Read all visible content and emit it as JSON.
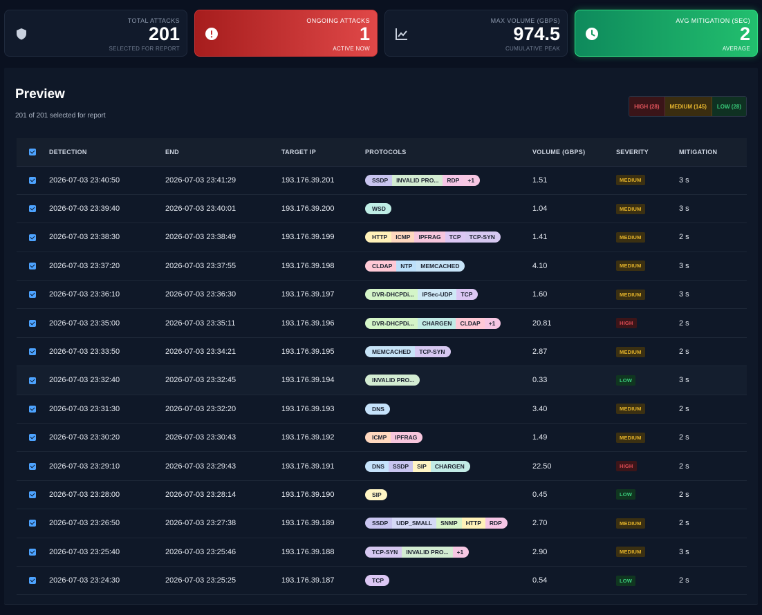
{
  "stats": {
    "total": {
      "label": "TOTAL ATTACKS",
      "value": "201",
      "sub": "SELECTED FOR REPORT",
      "icon": "shield-icon"
    },
    "ongoing": {
      "label": "ONGOING ATTACKS",
      "value": "1",
      "sub": "ACTIVE NOW",
      "icon": "alert-icon"
    },
    "volume": {
      "label": "MAX VOLUME (GBPS)",
      "value": "974.5",
      "sub": "CUMULATIVE PEAK",
      "icon": "chart-line-icon"
    },
    "mitigation": {
      "label": "AVG MITIGATION (SEC)",
      "value": "2",
      "sub": "AVERAGE",
      "icon": "clock-icon"
    }
  },
  "preview": {
    "title": "Preview",
    "subtitle": "201 of 201 selected for report",
    "legend": {
      "high": "HIGH (28)",
      "medium": "MEDIUM (145)",
      "low": "LOW (28)"
    }
  },
  "colors": {
    "SSDP": "#c9c5f0",
    "INVALID PRO...": "#d3ecd2",
    "RDP": "#f6c6e6",
    "+1": "#f7c7e3",
    "WSD": "#bfeee6",
    "HTTP": "#fff1b8",
    "ICMP": "#ffd8bf",
    "IPFRAG": "#f7c6dd",
    "TCP": "#dcc7f4",
    "TCP-SYN": "#d6c8f1",
    "CLDAP": "#ffc9d6",
    "NTP": "#bde0fb",
    "MEMCACHED": "#c6e3f7",
    "DVR-DHCPDi...": "#d4f5c8",
    "IPSec-UDP": "#cfe9f6",
    "CHARGEN": "#c2ebe6",
    "DNS": "#c5e2fb",
    "SIP": "#fff5c4",
    "UDP_SMALL": "#d5d9f6",
    "SNMP": "#d8f3c9"
  },
  "table": {
    "headers": [
      "DETECTION",
      "END",
      "TARGET IP",
      "PROTOCOLS",
      "VOLUME (GBPS)",
      "SEVERITY",
      "MITIGATION"
    ],
    "rows": [
      {
        "detection": "2026-07-03 23:40:50",
        "end": "2026-07-03 23:41:29",
        "ip": "193.176.39.201",
        "protocols": [
          "SSDP",
          "INVALID PRO...",
          "RDP",
          "+1"
        ],
        "volume": "1.51",
        "severity": "MEDIUM",
        "mitigation": "3 s"
      },
      {
        "detection": "2026-07-03 23:39:40",
        "end": "2026-07-03 23:40:01",
        "ip": "193.176.39.200",
        "protocols": [
          "WSD"
        ],
        "volume": "1.04",
        "severity": "MEDIUM",
        "mitigation": "3 s"
      },
      {
        "detection": "2026-07-03 23:38:30",
        "end": "2026-07-03 23:38:49",
        "ip": "193.176.39.199",
        "protocols": [
          "HTTP",
          "ICMP",
          "IPFRAG",
          "TCP",
          "TCP-SYN"
        ],
        "volume": "1.41",
        "severity": "MEDIUM",
        "mitigation": "2 s"
      },
      {
        "detection": "2026-07-03 23:37:20",
        "end": "2026-07-03 23:37:55",
        "ip": "193.176.39.198",
        "protocols": [
          "CLDAP",
          "NTP",
          "MEMCACHED"
        ],
        "volume": "4.10",
        "severity": "MEDIUM",
        "mitigation": "3 s"
      },
      {
        "detection": "2026-07-03 23:36:10",
        "end": "2026-07-03 23:36:30",
        "ip": "193.176.39.197",
        "protocols": [
          "DVR-DHCPDi...",
          "IPSec-UDP",
          "TCP"
        ],
        "volume": "1.60",
        "severity": "MEDIUM",
        "mitigation": "3 s"
      },
      {
        "detection": "2026-07-03 23:35:00",
        "end": "2026-07-03 23:35:11",
        "ip": "193.176.39.196",
        "protocols": [
          "DVR-DHCPDi...",
          "CHARGEN",
          "CLDAP",
          "+1"
        ],
        "volume": "20.81",
        "severity": "HIGH",
        "mitigation": "2 s"
      },
      {
        "detection": "2026-07-03 23:33:50",
        "end": "2026-07-03 23:34:21",
        "ip": "193.176.39.195",
        "protocols": [
          "MEMCACHED",
          "TCP-SYN"
        ],
        "volume": "2.87",
        "severity": "MEDIUM",
        "mitigation": "2 s"
      },
      {
        "detection": "2026-07-03 23:32:40",
        "end": "2026-07-03 23:32:45",
        "ip": "193.176.39.194",
        "protocols": [
          "INVALID PRO..."
        ],
        "volume": "0.33",
        "severity": "LOW",
        "mitigation": "3 s",
        "highlight": true
      },
      {
        "detection": "2026-07-03 23:31:30",
        "end": "2026-07-03 23:32:20",
        "ip": "193.176.39.193",
        "protocols": [
          "DNS"
        ],
        "volume": "3.40",
        "severity": "MEDIUM",
        "mitigation": "2 s"
      },
      {
        "detection": "2026-07-03 23:30:20",
        "end": "2026-07-03 23:30:43",
        "ip": "193.176.39.192",
        "protocols": [
          "ICMP",
          "IPFRAG"
        ],
        "volume": "1.49",
        "severity": "MEDIUM",
        "mitigation": "2 s"
      },
      {
        "detection": "2026-07-03 23:29:10",
        "end": "2026-07-03 23:29:43",
        "ip": "193.176.39.191",
        "protocols": [
          "DNS",
          "SSDP",
          "SIP",
          "CHARGEN"
        ],
        "volume": "22.50",
        "severity": "HIGH",
        "mitigation": "2 s"
      },
      {
        "detection": "2026-07-03 23:28:00",
        "end": "2026-07-03 23:28:14",
        "ip": "193.176.39.190",
        "protocols": [
          "SIP"
        ],
        "volume": "0.45",
        "severity": "LOW",
        "mitigation": "2 s"
      },
      {
        "detection": "2026-07-03 23:26:50",
        "end": "2026-07-03 23:27:38",
        "ip": "193.176.39.189",
        "protocols": [
          "SSDP",
          "UDP_SMALL",
          "SNMP",
          "HTTP",
          "RDP"
        ],
        "volume": "2.70",
        "severity": "MEDIUM",
        "mitigation": "2 s"
      },
      {
        "detection": "2026-07-03 23:25:40",
        "end": "2026-07-03 23:25:46",
        "ip": "193.176.39.188",
        "protocols": [
          "TCP-SYN",
          "INVALID PRO...",
          "+1"
        ],
        "volume": "2.90",
        "severity": "MEDIUM",
        "mitigation": "3 s"
      },
      {
        "detection": "2026-07-03 23:24:30",
        "end": "2026-07-03 23:25:25",
        "ip": "193.176.39.187",
        "protocols": [
          "TCP"
        ],
        "volume": "0.54",
        "severity": "LOW",
        "mitigation": "2 s"
      }
    ]
  }
}
